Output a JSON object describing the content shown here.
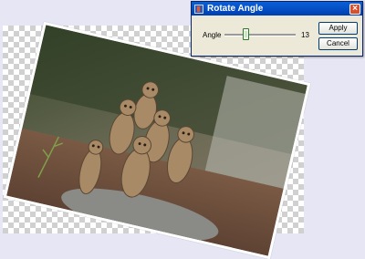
{
  "dialog": {
    "title": "Rotate Angle",
    "angle_label": "Angle",
    "angle_value": "13",
    "slider": {
      "min": 0,
      "max": 45,
      "value": 13
    },
    "apply_label": "Apply",
    "cancel_label": "Cancel"
  },
  "colors": {
    "titlebar": "#0a5fd8",
    "dialog_bg": "#ece9d8",
    "close": "#d7512e",
    "backdrop": "#e6e6f5"
  },
  "icons": [
    "app-icon",
    "close-icon"
  ]
}
